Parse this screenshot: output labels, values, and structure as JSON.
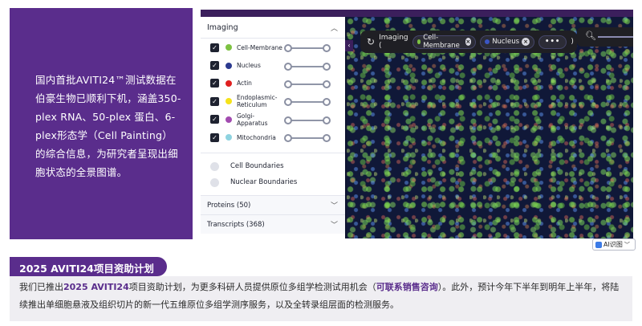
{
  "promo": {
    "text": "国内首批AVITI24™测试数据在伯豪生物已顺利下机，涵盖350-plex RNA、50-plex 蛋白、6-plex形态学（Cell Painting）的综合信息，为研究者呈现出细胞状态的全景图谱。"
  },
  "viewer": {
    "panel": {
      "imaging_title": "Imaging",
      "layers": [
        {
          "label": "Cell-Membrane",
          "color": "#7dc242"
        },
        {
          "label": "Nucleus",
          "color": "#2b3a8f"
        },
        {
          "label": "Actin",
          "color": "#e02020"
        },
        {
          "label": "Endoplasmic-Reticulum",
          "color": "#f5e21a"
        },
        {
          "label": "Golgi-Apparatus",
          "color": "#a24bb0"
        },
        {
          "label": "Mitochondria",
          "color": "#8ed3e0"
        }
      ],
      "toggles": [
        "Cell Boundaries",
        "Nuclear Boundaries"
      ],
      "proteins_label": "Proteins (50)",
      "transcripts_label": "Transcripts (368)"
    },
    "toolbar": {
      "label": "Imaging (",
      "closing": ")",
      "chips": [
        {
          "label": "Cell-Membrane",
          "color": "#7dc242"
        },
        {
          "label": "Nucleus",
          "color": "#3b56c4"
        }
      ],
      "more": "•••"
    }
  },
  "ai_button": {
    "label": "AI识图"
  },
  "funding": {
    "title": "2025 AVITI24项目资助计划",
    "body_prefix": "我们已推出",
    "body_highlight": "2025 AVITI24",
    "body_mid": "项目资助计划，为更多科研人员提供原位多组学检测试用机会（",
    "body_contact": "可联系销售咨询",
    "body_suffix": "）。此外，预计今年下半年到明年上半年，将陆续推出单细胞悬液及组织切片的新一代五维原位多组学测序服务，以及全转录组层面的检测服务。"
  }
}
